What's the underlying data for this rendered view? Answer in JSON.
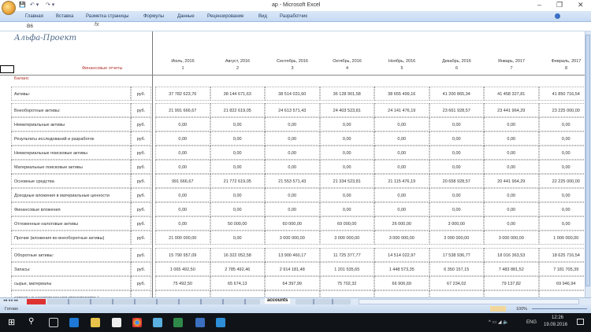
{
  "window": {
    "title": "ap - Microsoft Excel",
    "minimize": "–",
    "restore": "❐",
    "close": "✕"
  },
  "ribbon": {
    "tabs": [
      "Главная",
      "Вставка",
      "Разметка страницы",
      "Формулы",
      "Данные",
      "Рецензирование",
      "Вид",
      "Разработчик"
    ]
  },
  "formula_bar": {
    "name_box": "B6",
    "fx": "fx",
    "value": ""
  },
  "sheet": {
    "brand": "Альфа-Проект",
    "section_label": "Финансовые отчеты",
    "section_title": "Баланс",
    "months": [
      {
        "label": "Июль, 2016",
        "num": "1"
      },
      {
        "label": "Август, 2016",
        "num": "2"
      },
      {
        "label": "Сентябрь, 2016",
        "num": "3"
      },
      {
        "label": "Октябрь, 2016",
        "num": "4"
      },
      {
        "label": "Ноябрь, 2016",
        "num": "5"
      },
      {
        "label": "Декабрь, 2016",
        "num": "6"
      },
      {
        "label": "Январь, 2017",
        "num": "7"
      },
      {
        "label": "Февраль, 2017",
        "num": "8"
      }
    ],
    "rows": [
      {
        "label": "Активы:",
        "unit": "руб.",
        "values": [
          "37 782 623,76",
          "38 144 671,63",
          "38 514 031,60",
          "36 128 901,58",
          "38 655 499,16",
          "41 200 865,34",
          "41 458 327,81",
          "41 850 716,54"
        ]
      },
      {
        "label": "Внеоборотные активы:",
        "unit": "руб.",
        "values": [
          "21 991 666,67",
          "21 822 619,05",
          "24 613 571,43",
          "24 403 523,81",
          "24 141 476,19",
          "23 661 928,57",
          "23 441 964,29",
          "23 225 000,00"
        ]
      },
      {
        "label": "Нематериальные активы",
        "unit": "руб.",
        "values": [
          "0,00",
          "0,00",
          "0,00",
          "0,00",
          "0,00",
          "0,00",
          "0,00",
          "0,00"
        ]
      },
      {
        "label": "Результаты исследований и разработок",
        "unit": "руб.",
        "values": [
          "0,00",
          "0,00",
          "0,00",
          "0,00",
          "0,00",
          "0,00",
          "0,00",
          "0,00"
        ]
      },
      {
        "label": "Нематериальные поисковые активы",
        "unit": "руб.",
        "values": [
          "0,00",
          "0,00",
          "0,00",
          "0,00",
          "0,00",
          "0,00",
          "0,00",
          "0,00"
        ]
      },
      {
        "label": "Материальные поисковые активы",
        "unit": "руб.",
        "values": [
          "0,00",
          "0,00",
          "0,00",
          "0,00",
          "0,00",
          "0,00",
          "0,00",
          "0,00"
        ]
      },
      {
        "label": "Основные средства",
        "unit": "руб.",
        "values": [
          "991 666,67",
          "21 772 619,05",
          "21 553 571,43",
          "21 334 523,81",
          "21 115 476,19",
          "20 658 928,57",
          "20 441 964,29",
          "22 225 000,00"
        ]
      },
      {
        "label": "Доходные вложения в материальные ценности",
        "unit": "руб.",
        "values": [
          "0,00",
          "0,00",
          "0,00",
          "0,00",
          "0,00",
          "0,00",
          "0,00",
          "0,00"
        ]
      },
      {
        "label": "Финансовые вложения",
        "unit": "руб.",
        "values": [
          "0,00",
          "0,00",
          "0,00",
          "0,00",
          "0,00",
          "0,00",
          "0,00",
          "0,00"
        ]
      },
      {
        "label": "Отложенные налоговые активы",
        "unit": "руб.",
        "values": [
          "0,00",
          "50 000,00",
          "60 000,00",
          "69 000,00",
          "26 000,00",
          "3 000,00",
          "0,00",
          "0,00"
        ]
      },
      {
        "label": "Прочие (вложения во внеоборотные активы)",
        "unit": "руб.",
        "values": [
          "21 000 000,00",
          "0,00",
          "3 000 000,00",
          "3 000 000,00",
          "3 000 000,00",
          "3 000 000,00",
          "3 000 000,00",
          "1 000 000,00"
        ]
      },
      {
        "label": "Оборотные активы:",
        "unit": "руб.",
        "values": [
          "15 790 957,09",
          "16 322 052,58",
          "13 900 460,17",
          "11 725 377,77",
          "14 514 022,97",
          "17 538 936,77",
          "18 016 363,53",
          "18 625 716,54"
        ]
      },
      {
        "label": "Запасы:",
        "unit": "руб.",
        "values": [
          "1 065 492,50",
          "2 785 492,46",
          "2 914 181,48",
          "1 201 535,65",
          "1 448 573,35",
          "6 350 157,15",
          "7 483 881,52",
          "7 181 705,39"
        ]
      },
      {
        "label": "сырье, материалы",
        "unit": "руб.",
        "values": [
          "75 492,50",
          "65 674,13",
          "64 397,99",
          "75 702,32",
          "66 906,69",
          "67 234,02",
          "79 137,82",
          "69 946,94"
        ]
      },
      {
        "label": "затраты в незавершенном производстве /",
        "unit": "",
        "values": [
          "",
          "",
          "",
          "",
          "",
          "",
          "",
          ""
        ]
      }
    ]
  },
  "sheet_tabs": {
    "active": "accounts"
  },
  "status": {
    "ready": "Готово",
    "zoom": "100%"
  },
  "taskbar": {
    "lang": "ENG",
    "time": "12:26",
    "date": "19.09.2016"
  },
  "colors": {
    "accent_red": "#b0302a",
    "ribbon": "#c6daf3",
    "taskbar": "#101418"
  }
}
